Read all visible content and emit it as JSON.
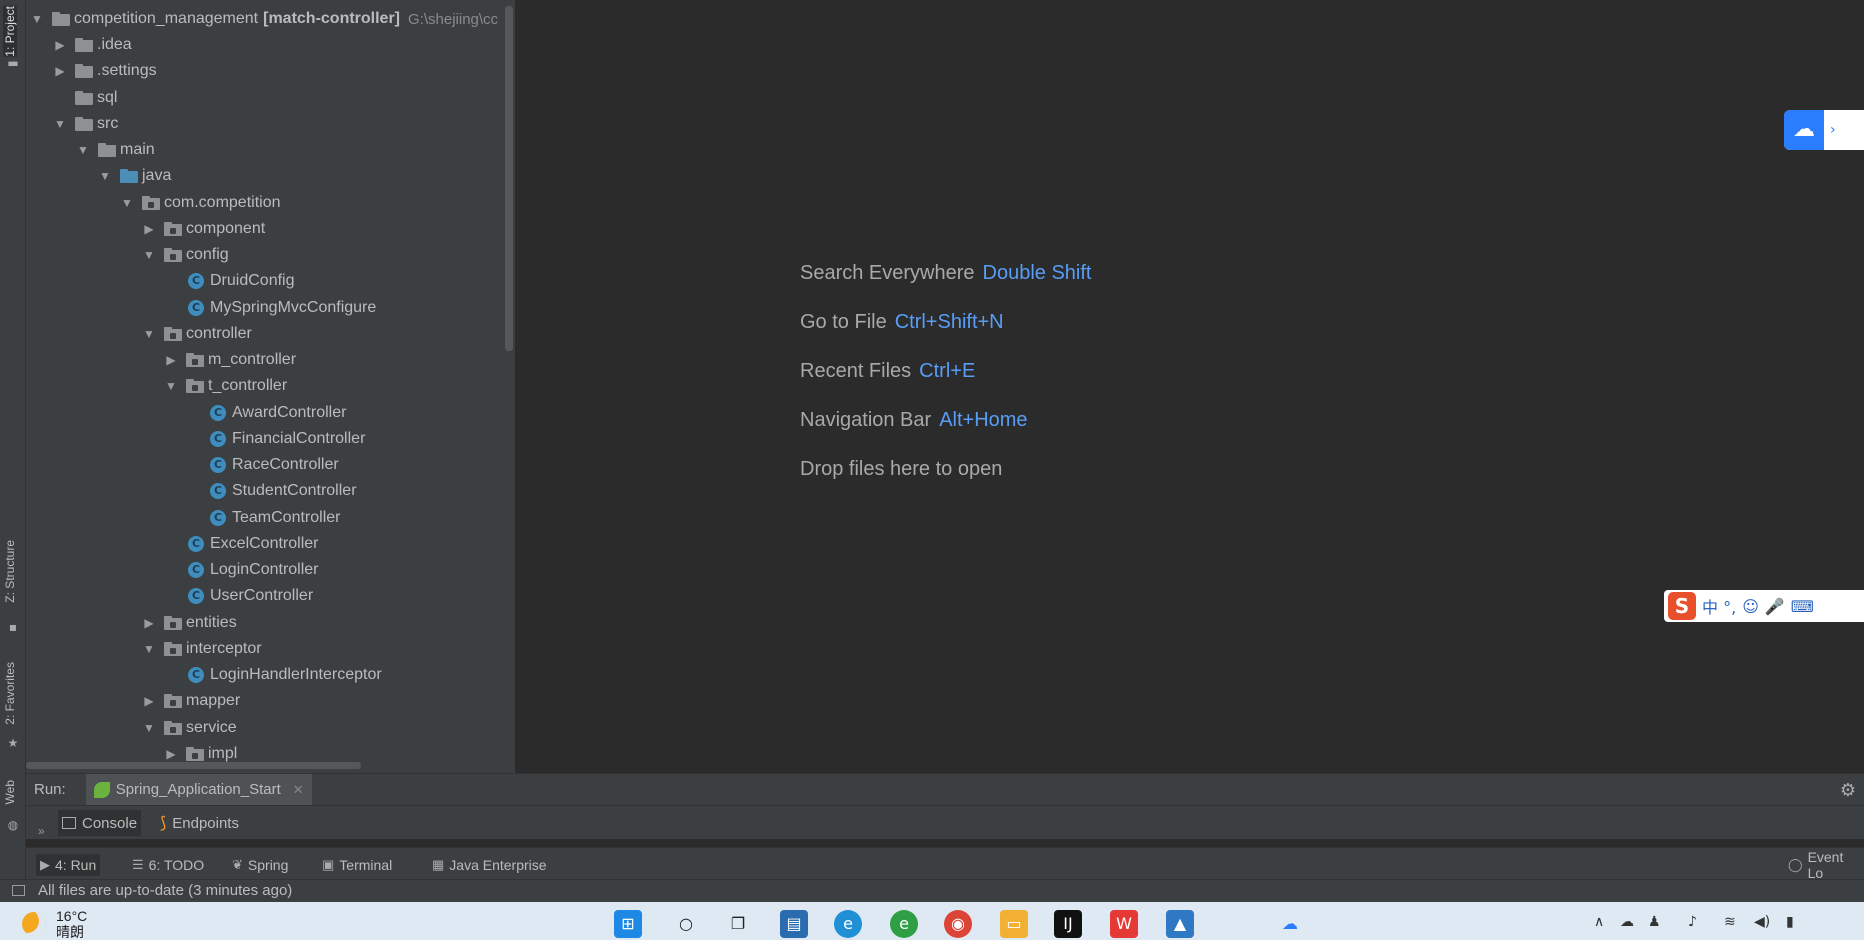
{
  "side_tabs": {
    "project": "1: Project",
    "structure": "Z: Structure",
    "favorites": "2: Favorites",
    "web": "Web"
  },
  "project": {
    "root_name": "competition_management",
    "root_module": "[match-controller]",
    "root_path": "G:\\shejiing\\cc",
    "items": [
      {
        "label": ".idea"
      },
      {
        "label": ".settings"
      },
      {
        "label": "sql"
      },
      {
        "label": "src"
      },
      {
        "label": "main"
      },
      {
        "label": "java"
      },
      {
        "label": "com.competition"
      },
      {
        "label": "component"
      },
      {
        "label": "config"
      },
      {
        "label": "DruidConfig"
      },
      {
        "label": "MySpringMvcConfigure"
      },
      {
        "label": "controller"
      },
      {
        "label": "m_controller"
      },
      {
        "label": "t_controller"
      },
      {
        "label": "AwardController"
      },
      {
        "label": "FinancialController"
      },
      {
        "label": "RaceController"
      },
      {
        "label": "StudentController"
      },
      {
        "label": "TeamController"
      },
      {
        "label": "ExcelController"
      },
      {
        "label": "LoginController"
      },
      {
        "label": "UserController"
      },
      {
        "label": "entities"
      },
      {
        "label": "interceptor"
      },
      {
        "label": "LoginHandlerInterceptor"
      },
      {
        "label": "mapper"
      },
      {
        "label": "service"
      },
      {
        "label": "impl"
      }
    ]
  },
  "editor": {
    "hints": [
      {
        "label": "Search Everywhere",
        "key": "Double Shift"
      },
      {
        "label": "Go to File",
        "key": "Ctrl+Shift+N"
      },
      {
        "label": "Recent Files",
        "key": "Ctrl+E"
      },
      {
        "label": "Navigation Bar",
        "key": "Alt+Home"
      },
      {
        "label": "Drop files here to open",
        "key": ""
      }
    ]
  },
  "run": {
    "label": "Run:",
    "config": "Spring_Application_Start",
    "tabs": [
      "Console",
      "Endpoints"
    ]
  },
  "tool_windows": {
    "run": "4: Run",
    "todo": "6: TODO",
    "spring": "Spring",
    "terminal": "Terminal",
    "java_enterprise": "Java Enterprise",
    "event_log": "Event Lo"
  },
  "status": {
    "message": "All files are up-to-date (3 minutes ago)"
  },
  "taskbar": {
    "temperature": "16°C",
    "weather_text": "晴朗"
  },
  "overlay": {
    "ime_label": "中 °,"
  },
  "colors": {
    "accent": "#589df6",
    "panel": "#3c3f41",
    "editor": "#2b2b2b"
  }
}
